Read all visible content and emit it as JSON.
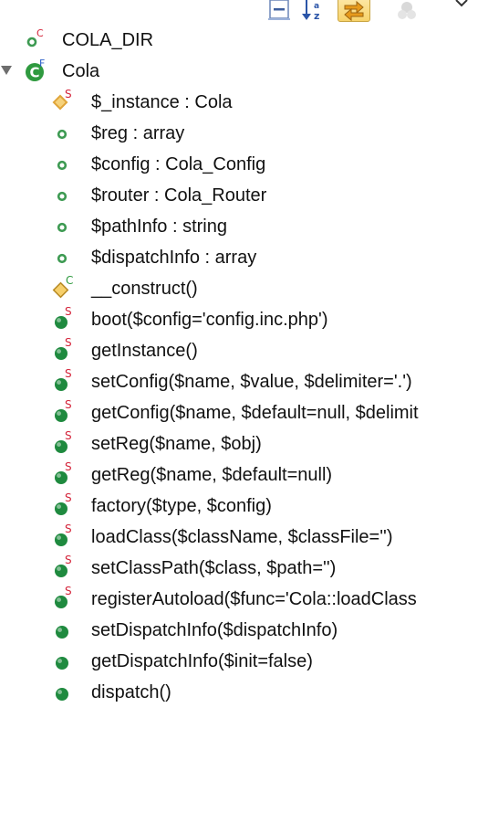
{
  "colors": {
    "field_green": "#3d9a52",
    "method_green": "#1f8a3f",
    "static_red": "#d4243a",
    "constructor_orange": "#e0a53a",
    "class_green": "#2f9a3f",
    "final_blue": "#2a5ec8"
  },
  "toolbar": {
    "collapse_all_icon": "collapse-all-icon",
    "sort_icon": "sort-alphabetical-icon",
    "link_editor_icon": "link-with-editor-icon",
    "hide_icon": "hide-fields-icon",
    "menu_icon": "view-menu-icon"
  },
  "outline": {
    "constant": {
      "label": "COLA_DIR",
      "badge": "C"
    },
    "class": {
      "label": "Cola",
      "badge": "F"
    },
    "members": [
      {
        "label": "$_instance : Cola",
        "kind": "static-private-field",
        "badge": "S"
      },
      {
        "label": "$reg : array",
        "kind": "field"
      },
      {
        "label": "$config : Cola_Config",
        "kind": "field"
      },
      {
        "label": "$router : Cola_Router",
        "kind": "field"
      },
      {
        "label": "$pathInfo : string",
        "kind": "field"
      },
      {
        "label": "$dispatchInfo : array",
        "kind": "field"
      },
      {
        "label": "__construct()",
        "kind": "constructor",
        "badge": "C"
      },
      {
        "label": "boot($config='config.inc.php')",
        "kind": "static-method",
        "badge": "S"
      },
      {
        "label": "getInstance()",
        "kind": "static-method",
        "badge": "S"
      },
      {
        "label": "setConfig($name, $value, $delimiter='.')",
        "kind": "static-method",
        "badge": "S"
      },
      {
        "label": "getConfig($name, $default=null, $delimit",
        "kind": "static-method",
        "badge": "S"
      },
      {
        "label": "setReg($name, $obj)",
        "kind": "static-method",
        "badge": "S"
      },
      {
        "label": "getReg($name, $default=null)",
        "kind": "static-method",
        "badge": "S"
      },
      {
        "label": "factory($type, $config)",
        "kind": "static-method",
        "badge": "S"
      },
      {
        "label": "loadClass($className, $classFile='')",
        "kind": "static-method",
        "badge": "S"
      },
      {
        "label": "setClassPath($class, $path='')",
        "kind": "static-method",
        "badge": "S"
      },
      {
        "label": "registerAutoload($func='Cola::loadClass",
        "kind": "static-method",
        "badge": "S"
      },
      {
        "label": "setDispatchInfo($dispatchInfo)",
        "kind": "method"
      },
      {
        "label": "getDispatchInfo($init=false)",
        "kind": "method"
      },
      {
        "label": "dispatch()",
        "kind": "method"
      }
    ]
  }
}
